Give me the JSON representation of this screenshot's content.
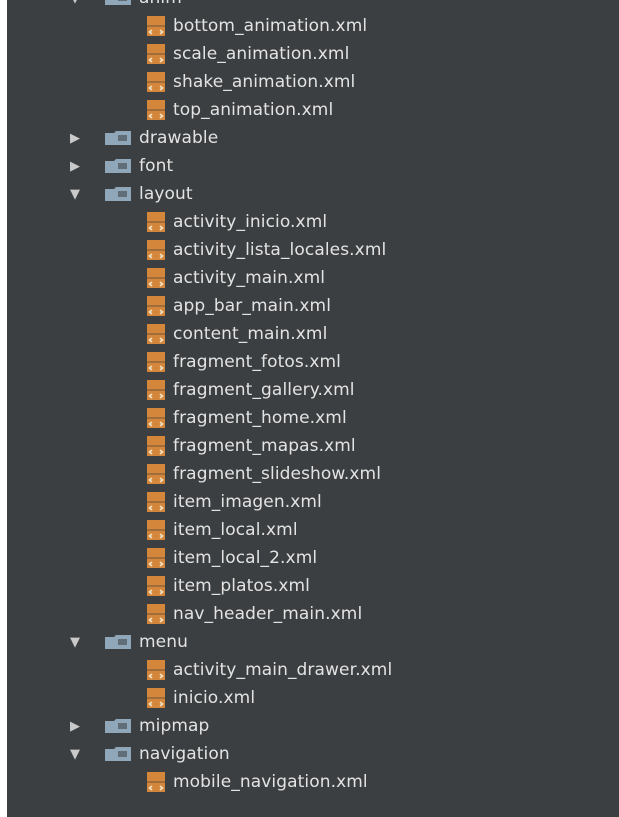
{
  "tree": [
    {
      "type": "folder",
      "name": "anim",
      "expanded": true,
      "children": [
        "bottom_animation.xml",
        "scale_animation.xml",
        "shake_animation.xml",
        "top_animation.xml"
      ]
    },
    {
      "type": "folder",
      "name": "drawable",
      "expanded": false,
      "children": []
    },
    {
      "type": "folder",
      "name": "font",
      "expanded": false,
      "children": []
    },
    {
      "type": "folder",
      "name": "layout",
      "expanded": true,
      "children": [
        "activity_inicio.xml",
        "activity_lista_locales.xml",
        "activity_main.xml",
        "app_bar_main.xml",
        "content_main.xml",
        "fragment_fotos.xml",
        "fragment_gallery.xml",
        "fragment_home.xml",
        "fragment_mapas.xml",
        "fragment_slideshow.xml",
        "item_imagen.xml",
        "item_local.xml",
        "item_local_2.xml",
        "item_platos.xml",
        "nav_header_main.xml"
      ]
    },
    {
      "type": "folder",
      "name": "menu",
      "expanded": true,
      "children": [
        "activity_main_drawer.xml",
        "inicio.xml"
      ]
    },
    {
      "type": "folder",
      "name": "mipmap",
      "expanded": false,
      "children": []
    },
    {
      "type": "folder",
      "name": "navigation",
      "expanded": true,
      "children": [
        "mobile_navigation.xml"
      ]
    }
  ],
  "icons": {
    "expanded": "▼",
    "collapsed": "▶",
    "folder_color": "#8fa7b8",
    "file_color": "#d4873a"
  }
}
